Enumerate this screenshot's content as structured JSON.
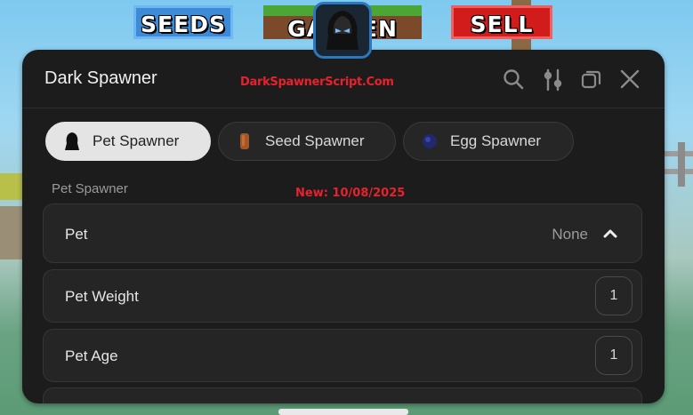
{
  "topbar": {
    "seeds_label": "SEEDS",
    "garden_label": "GARDEN",
    "sell_label": "SELL"
  },
  "panel": {
    "title": "Dark Spawner",
    "watermark": "DarkSpawnerScript.Com",
    "header_icons": [
      "search-icon",
      "settings-sliders-icon",
      "windows-icon",
      "close-icon"
    ],
    "tabs": [
      {
        "label": "Pet Spawner",
        "icon": "pet-icon",
        "active": true
      },
      {
        "label": "Seed Spawner",
        "icon": "seed-icon",
        "active": false
      },
      {
        "label": "Egg Spawner",
        "icon": "egg-icon",
        "active": false
      }
    ],
    "section_label": "Pet Spawner",
    "new_note": "New: 10/08/2025",
    "rows": [
      {
        "label": "Pet",
        "value": "None",
        "icon": "chevron-up-icon"
      },
      {
        "label": "Pet Weight",
        "value": "1"
      },
      {
        "label": "Pet Age",
        "value": "1"
      }
    ]
  },
  "colors": {
    "panel_bg": "#1c1c1c",
    "active_tab_bg": "#e4e4e4",
    "watermark": "#e8222d"
  }
}
